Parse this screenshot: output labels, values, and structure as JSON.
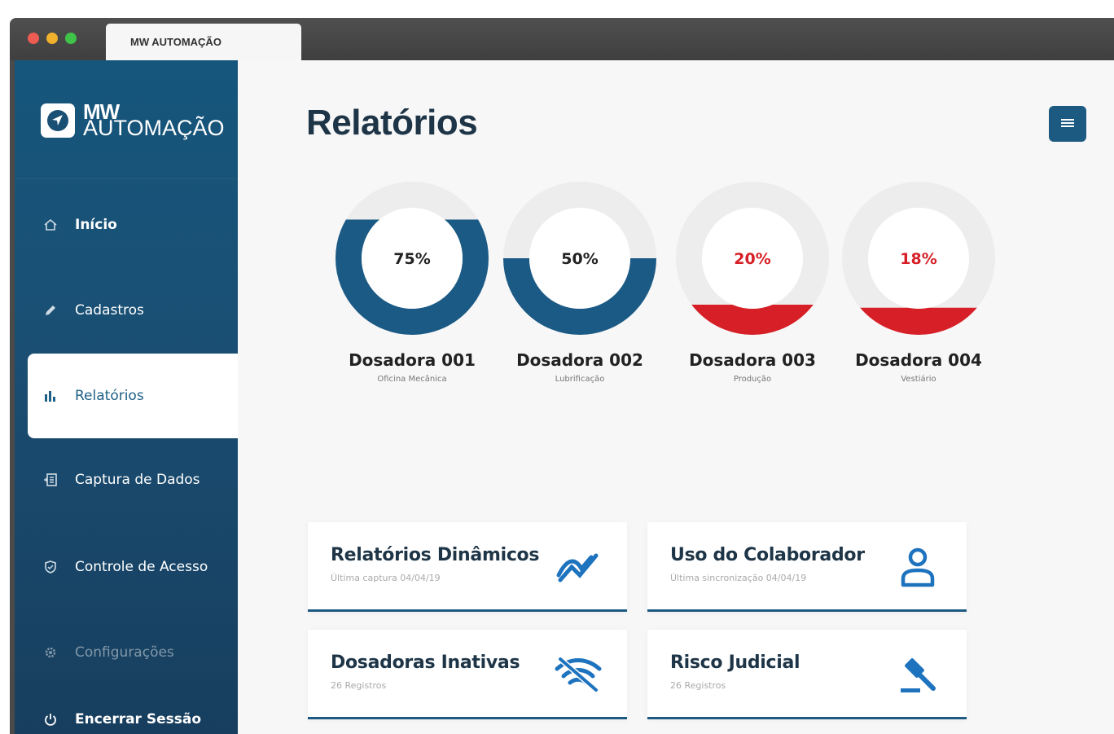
{
  "window": {
    "tab_title": "MW AUTOMAÇÃO"
  },
  "sidebar": {
    "logo": {
      "line1": "MW",
      "line2": "AUTOMAÇÃO"
    },
    "items": [
      {
        "label": "Início",
        "icon": "home-icon"
      },
      {
        "label": "Cadastros",
        "icon": "pencil-icon"
      },
      {
        "label": "Relatórios",
        "icon": "bar-chart-icon",
        "active": true
      },
      {
        "label": "Captura de Dados",
        "icon": "data-capture-icon"
      },
      {
        "label": "Controle de Acesso",
        "icon": "shield-icon"
      },
      {
        "label": "Configurações",
        "icon": "gear-icon",
        "disabled": true
      },
      {
        "label": "Encerrar Sessão",
        "icon": "power-icon"
      }
    ]
  },
  "main": {
    "title": "Relatórios",
    "gauges": [
      {
        "percent_label": "75%",
        "value": 0.75,
        "name": "Dosadora 001",
        "location": "Oficina Mecânica",
        "color": "#1b5a84",
        "text_color": "#222222"
      },
      {
        "percent_label": "50%",
        "value": 0.5,
        "name": "Dosadora 002",
        "location": "Lubrificação",
        "color": "#1b5a84",
        "text_color": "#222222"
      },
      {
        "percent_label": "20%",
        "value": 0.2,
        "name": "Dosadora 003",
        "location": "Produção",
        "color": "#d61f26",
        "text_color": "#d61f26"
      },
      {
        "percent_label": "18%",
        "value": 0.18,
        "name": "Dosadora 004",
        "location": "Vestiário",
        "color": "#d61f26",
        "text_color": "#d61f26"
      }
    ],
    "cards": [
      {
        "title": "Relatórios Dinâmicos",
        "subtitle": "Última captura 04/04/19",
        "icon": "trend-chart-icon"
      },
      {
        "title": "Uso do Colaborador",
        "subtitle": "Última sincronização 04/04/19",
        "icon": "user-icon"
      },
      {
        "title": "Dosadoras Inativas",
        "subtitle": "26 Registros",
        "icon": "wifi-off-icon"
      },
      {
        "title": "Risco Judicial",
        "subtitle": "26 Registros",
        "icon": "gavel-icon"
      }
    ]
  },
  "colors": {
    "sidebar": "#1a4f74",
    "accent": "#1d5a82",
    "alert": "#d61f26",
    "track": "#ededed"
  }
}
